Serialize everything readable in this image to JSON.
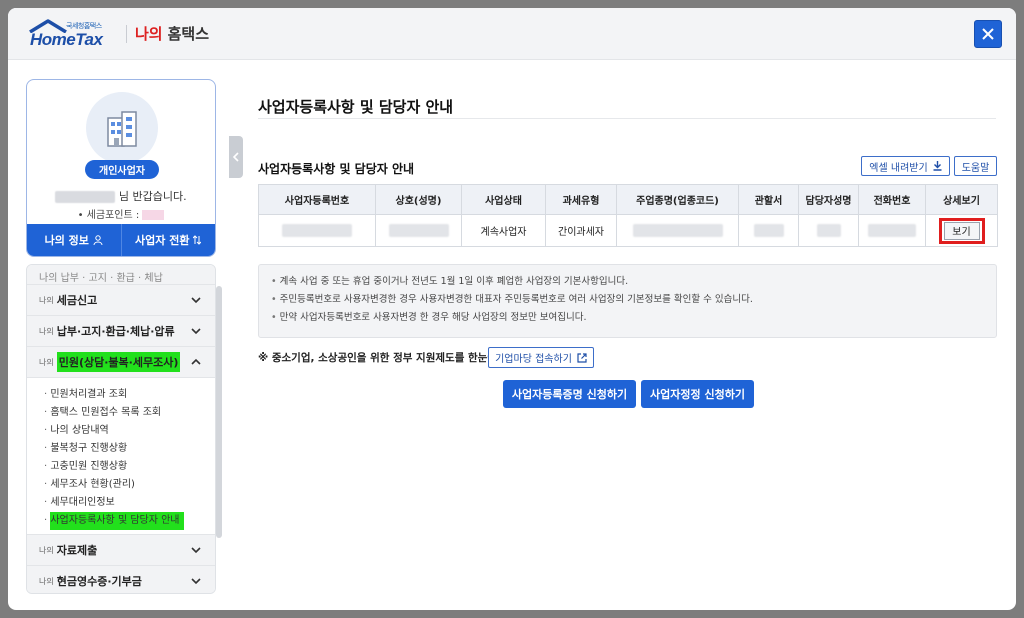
{
  "header": {
    "logo_small": "국세청홈택스",
    "logo_word": "HomeTax",
    "my_prefix": "나의",
    "my_title": "홈택스"
  },
  "profile": {
    "badge": "개인사업자",
    "greeting_suffix": "님 반갑습니다.",
    "points_label": "• 세금포인트 :",
    "my_info_button": "나의 정보",
    "switch_button": "사업자 전환"
  },
  "menu": {
    "cut_top": "나의 납부 · 고지 · 환급 · 체납",
    "prefix": "나의",
    "items": [
      {
        "label": "세금신고"
      },
      {
        "label": "납부·고지·환급·체납·압류"
      },
      {
        "label": "민원(상담·불복·세무조사)"
      },
      {
        "label": "자료제출"
      },
      {
        "label": "현금영수증·기부금"
      }
    ],
    "sub_items": [
      "민원처리결과 조회",
      "홈택스 민원접수 목록 조회",
      "나의 상담내역",
      "불복청구 진행상황",
      "고충민원 진행상황",
      "세무조사 현황(관리)",
      "세무대리인정보",
      "사업자등록사항 및 담당자 안내"
    ]
  },
  "main": {
    "page_title": "사업자등록사항 및 담당자 안내",
    "section_title": "사업자등록사항 및 담당자 안내",
    "excel_button": "엑셀 내려받기",
    "help_button": "도움말",
    "columns": [
      "사업자등록번호",
      "상호(성명)",
      "사업상태",
      "과세유형",
      "주업종명(업종코드)",
      "관할서",
      "담당자성명",
      "전화번호",
      "상세보기"
    ],
    "row": {
      "status": "계속사업자",
      "tax_type": "간이과세자",
      "view_button": "보기"
    },
    "notices": [
      "계속 사업 중 또는 휴업 중이거나 전년도 1월 1일 이후 폐업한 사업장의 기본사항입니다.",
      "주민등록번호로 사용자변경한 경우 사용자변경한 대표자 주민등록번호로 여러 사업장의 기본정보를 확인할 수 있습니다.",
      "만약 사업자등록번호로 사용자변경 한 경우 해당 사업장의 정보만 보여집니다."
    ],
    "support_text": "※ 중소기업, 소상공인을 위한 정부 지원제도를 한눈에!",
    "biz_button": "기업마당 접속하기",
    "apply_cert_button": "사업자등록증명 신청하기",
    "apply_correct_button": "사업자정정 신청하기"
  },
  "colors": {
    "primary": "#1f63d6",
    "highlight": "#22e01c",
    "alert_outline": "#e01e1e"
  }
}
